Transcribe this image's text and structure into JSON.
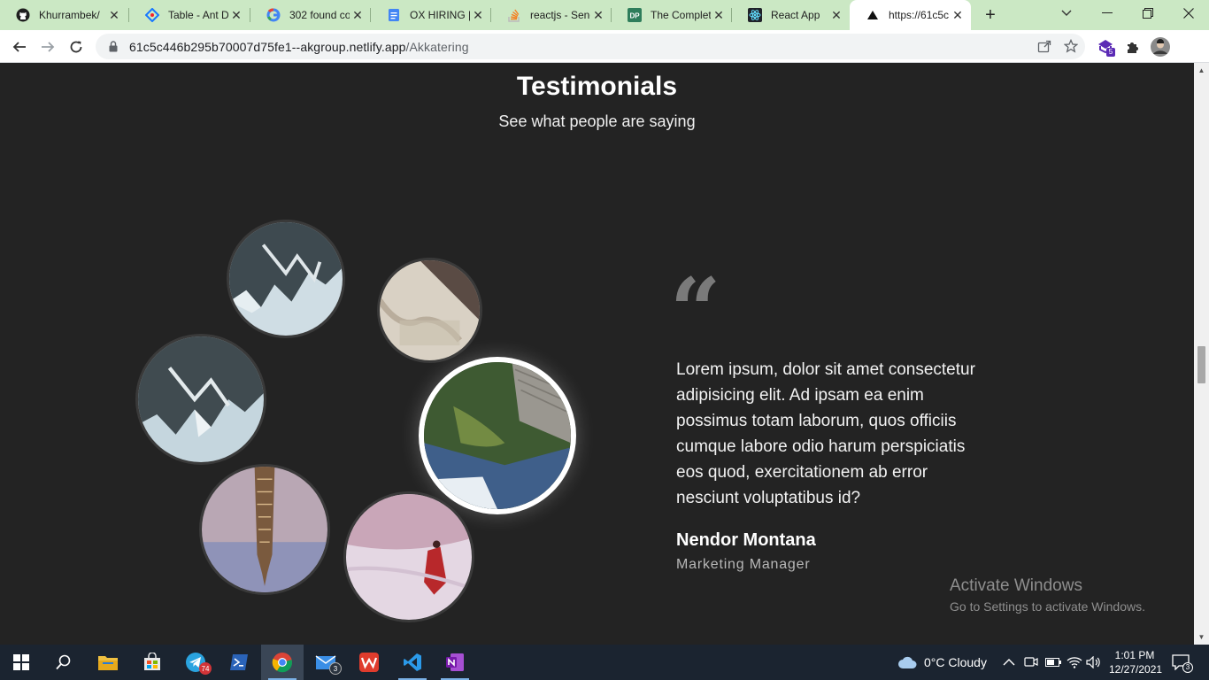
{
  "browser": {
    "tabs": [
      {
        "title": "Khurrambek/",
        "icon": "github-icon",
        "active": false
      },
      {
        "title": "Table - Ant D",
        "icon": "ant-design-icon",
        "active": false
      },
      {
        "title": "302 found co",
        "icon": "google-icon",
        "active": false
      },
      {
        "title": "OX HIRING | F",
        "icon": "google-docs-icon",
        "active": false
      },
      {
        "title": "reactjs - Send",
        "icon": "stackoverflow-icon",
        "active": false
      },
      {
        "title": "The Complete",
        "icon": "dp-icon",
        "active": false
      },
      {
        "title": "React App",
        "icon": "react-icon",
        "active": false
      },
      {
        "title": "https://61c5c",
        "icon": "netlify-triangle-icon",
        "active": true
      }
    ],
    "address": {
      "host": "61c5c446b295b70007d75fe1--akgroup.netlify.app",
      "path": "/Akkatering"
    },
    "extension_badge": "5",
    "accent": "#cbe8c4"
  },
  "page": {
    "heading": "Testimonials",
    "subheading": "See what people are saying",
    "quote_mark": "“",
    "testimonial": {
      "text": "Lorem ipsum, dolor sit amet consectetur adipisicing elit. Ad ipsam ea enim possimus totam laborum, quos officiis cumque labore odio harum perspiciatis eos quod, exercitationem ab error nesciunt voluptatibus id?",
      "author": "Nendor Montana",
      "role": "Marketing Manager"
    },
    "avatars": [
      {
        "name": "mountain-photo-1",
        "active": false
      },
      {
        "name": "beach-photo",
        "active": false
      },
      {
        "name": "mountain-photo-2",
        "active": false
      },
      {
        "name": "lake-dock-photo",
        "active": true
      },
      {
        "name": "skyscraper-photo",
        "active": false
      },
      {
        "name": "snow-person-photo",
        "active": false
      }
    ],
    "watermark": {
      "line1": "Activate Windows",
      "line2": "Go to Settings to activate Windows."
    },
    "background": "#232323"
  },
  "taskbar": {
    "telegram_badge": "74",
    "mail_badge": "3",
    "weather": "0°C  Cloudy",
    "time": "1:01 PM",
    "date": "12/27/2021",
    "notifications": "3"
  }
}
